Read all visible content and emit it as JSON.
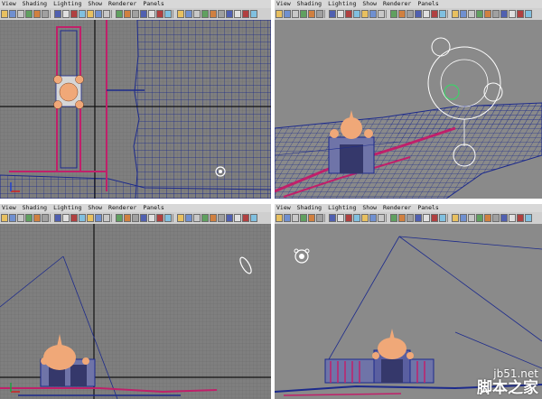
{
  "menu": [
    "View",
    "Shading",
    "Lighting",
    "Show",
    "Renderer",
    "Panels"
  ],
  "toolbar_icon_count": 30,
  "colors": {
    "grid_fill_ortho": "#7f7f7f",
    "grid_fill_persp": "#8a8a8a",
    "wire": "#1c2a8c",
    "accent_pink": "#c0206a",
    "dome": "#f0a878",
    "active_border": "#2c5a96"
  },
  "viewports": [
    {
      "name": "top",
      "active": false
    },
    {
      "name": "persp-top-right",
      "active": false
    },
    {
      "name": "front",
      "active": false
    },
    {
      "name": "persp-bottom-right",
      "active": true
    }
  ],
  "watermark": {
    "url": "jb51.net",
    "cn": "脚本之家"
  }
}
